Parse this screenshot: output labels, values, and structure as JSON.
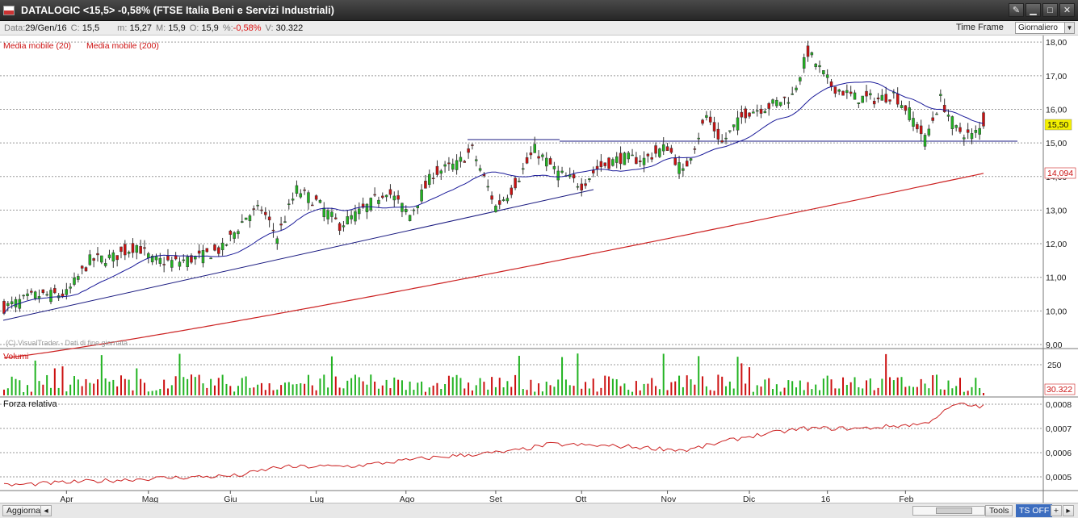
{
  "window": {
    "title": "DATALOGIC <15,5> -0,58%  (FTSE Italia Beni e Servizi Industriali)"
  },
  "infobar": {
    "data_label": "Data:",
    "data_value": "29/Gen/16",
    "close_label": "C:",
    "close_value": "15,5",
    "min_label": "m:",
    "min_value": "15,27",
    "max_label": "M:",
    "max_value": "15,9",
    "open_label": "O:",
    "open_value": "15,9",
    "pct_label": "%:",
    "pct_value": "-0,58%",
    "vol_label": "V:",
    "vol_value": "30.322",
    "timeframe_label": "Time Frame",
    "timeframe_selected": "Giornaliero"
  },
  "colors": {
    "up": "#22b322",
    "down": "#cc1111",
    "ma20": "#1a1a99",
    "ma200": "#cc2222",
    "trendline": "#1a1a80",
    "rs_line": "#cc2222",
    "grid": "#9a9a9a"
  },
  "chart_data": [
    {
      "type": "candlestick",
      "legend": [
        {
          "name": "Media mobile (20)"
        },
        {
          "name": "Media mobile (200)"
        }
      ],
      "watermark": "(C) VisualTrader - Dati di fine giornata",
      "ylim": [
        9,
        18.1
      ],
      "y_ticks": [
        "9,00",
        "10,00",
        "11,00",
        "12,00",
        "13,00",
        "14,00",
        "15,00",
        "16,00",
        "17,00",
        "18,00"
      ],
      "x_ticks": [
        "Apr",
        "Mag",
        "Giu",
        "Lug",
        "Ago",
        "Set",
        "Ott",
        "Nov",
        "Dic",
        "16",
        "Feb"
      ],
      "last_price_label": "15,50",
      "ma200_label": "14,094",
      "anchors": [
        {
          "i": 0,
          "c": 10.1
        },
        {
          "i": 8,
          "c": 10.45
        },
        {
          "i": 16,
          "c": 10.5
        },
        {
          "i": 22,
          "c": 11.5
        },
        {
          "i": 28,
          "c": 11.6
        },
        {
          "i": 34,
          "c": 11.95
        },
        {
          "i": 38,
          "c": 11.5
        },
        {
          "i": 44,
          "c": 11.45
        },
        {
          "i": 50,
          "c": 11.6
        },
        {
          "i": 56,
          "c": 11.85
        },
        {
          "i": 62,
          "c": 12.8
        },
        {
          "i": 66,
          "c": 13.05
        },
        {
          "i": 70,
          "c": 12.2
        },
        {
          "i": 75,
          "c": 13.6
        },
        {
          "i": 80,
          "c": 13.25
        },
        {
          "i": 86,
          "c": 12.55
        },
        {
          "i": 92,
          "c": 13.0
        },
        {
          "i": 98,
          "c": 13.6
        },
        {
          "i": 104,
          "c": 12.85
        },
        {
          "i": 110,
          "c": 14.1
        },
        {
          "i": 116,
          "c": 14.35
        },
        {
          "i": 120,
          "c": 14.8
        },
        {
          "i": 126,
          "c": 13.1
        },
        {
          "i": 130,
          "c": 13.6
        },
        {
          "i": 136,
          "c": 14.8
        },
        {
          "i": 142,
          "c": 14.1
        },
        {
          "i": 148,
          "c": 13.75
        },
        {
          "i": 152,
          "c": 14.25
        },
        {
          "i": 158,
          "c": 14.55
        },
        {
          "i": 164,
          "c": 14.5
        },
        {
          "i": 170,
          "c": 14.9
        },
        {
          "i": 174,
          "c": 14.1
        },
        {
          "i": 180,
          "c": 15.8
        },
        {
          "i": 184,
          "c": 15.0
        },
        {
          "i": 190,
          "c": 15.9
        },
        {
          "i": 196,
          "c": 16.1
        },
        {
          "i": 202,
          "c": 16.4
        },
        {
          "i": 206,
          "c": 17.7
        },
        {
          "i": 212,
          "c": 16.7
        },
        {
          "i": 218,
          "c": 16.35
        },
        {
          "i": 224,
          "c": 16.3
        },
        {
          "i": 228,
          "c": 16.45
        },
        {
          "i": 232,
          "c": 15.9
        },
        {
          "i": 236,
          "c": 15.1
        },
        {
          "i": 240,
          "c": 16.3
        },
        {
          "i": 244,
          "c": 15.4
        },
        {
          "i": 248,
          "c": 15.2
        },
        {
          "i": 251,
          "c": 15.5
        }
      ]
    },
    {
      "type": "bar",
      "title": "Volumi",
      "y_ticks": [
        "250"
      ],
      "last_value_label": "30.322"
    },
    {
      "type": "line",
      "title": "Forza relativa",
      "ylim": [
        0.00045,
        0.00082
      ],
      "y_ticks": [
        "0,0005",
        "0,0006",
        "0,0007",
        "0,0008"
      ],
      "anchors": [
        {
          "i": 0,
          "v": 0.000465
        },
        {
          "i": 20,
          "v": 0.00048
        },
        {
          "i": 40,
          "v": 0.000495
        },
        {
          "i": 60,
          "v": 0.000505
        },
        {
          "i": 70,
          "v": 0.00054
        },
        {
          "i": 90,
          "v": 0.000545
        },
        {
          "i": 110,
          "v": 0.00058
        },
        {
          "i": 130,
          "v": 0.000605
        },
        {
          "i": 140,
          "v": 0.000635
        },
        {
          "i": 160,
          "v": 0.000625
        },
        {
          "i": 175,
          "v": 0.00061
        },
        {
          "i": 190,
          "v": 0.000665
        },
        {
          "i": 205,
          "v": 0.0007
        },
        {
          "i": 220,
          "v": 0.0007
        },
        {
          "i": 236,
          "v": 0.00072
        },
        {
          "i": 244,
          "v": 0.0008
        },
        {
          "i": 251,
          "v": 0.00079
        }
      ]
    }
  ],
  "statusbar": {
    "aggiorna_label": "Aggiorna",
    "tools_label": "Tools",
    "ts_label": "TS OFF"
  }
}
